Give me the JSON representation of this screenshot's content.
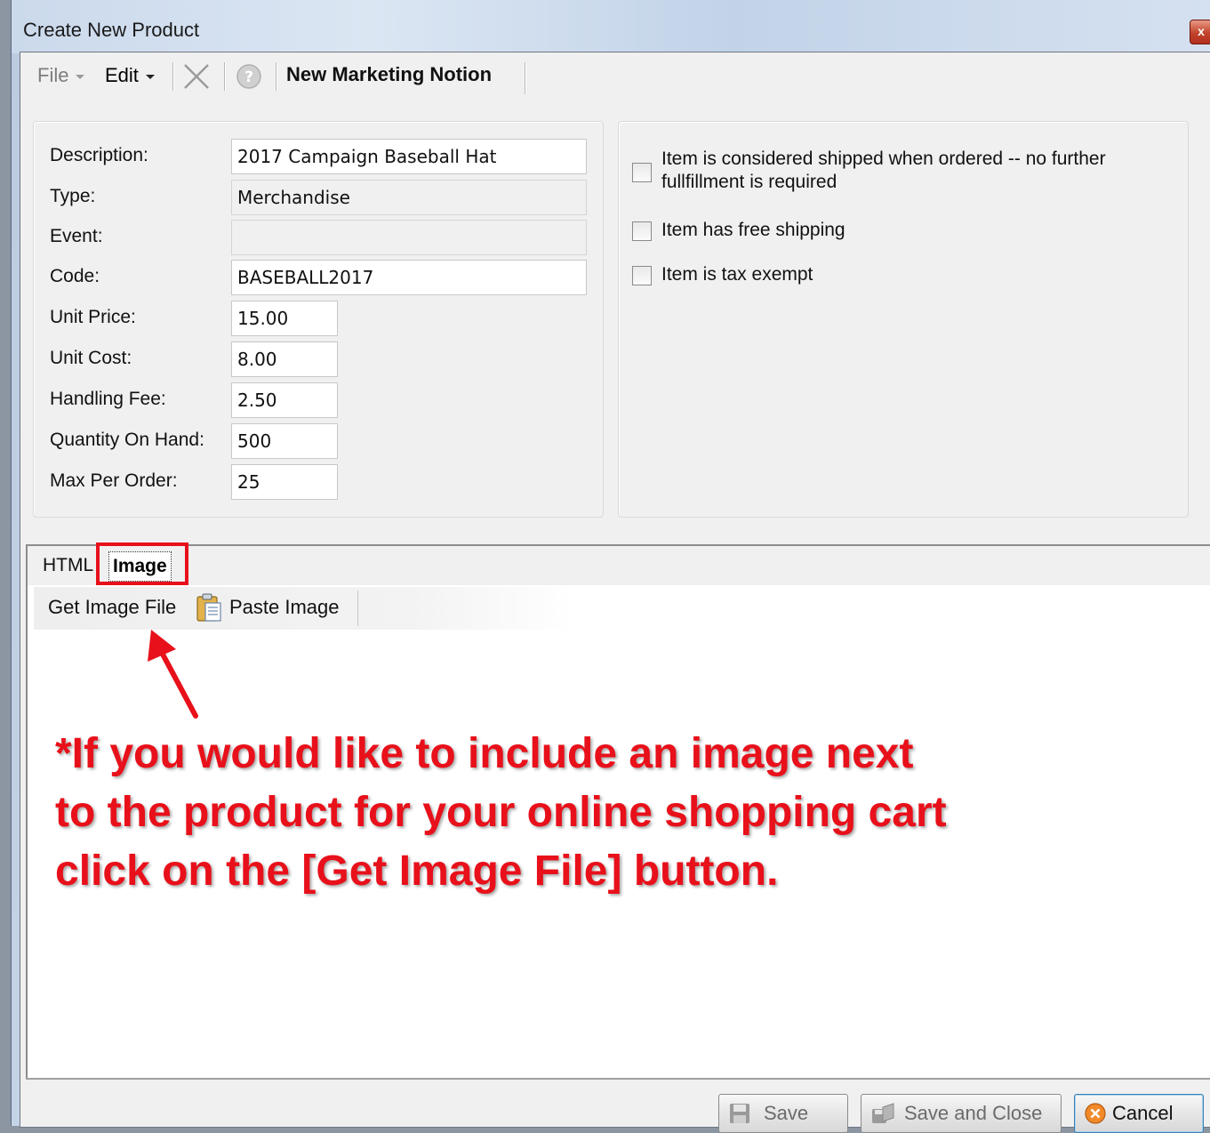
{
  "window": {
    "title": "Create New Product",
    "close_label": "x"
  },
  "menu": {
    "file": "File",
    "edit": "Edit",
    "title": "New Marketing Notion"
  },
  "form": {
    "description": {
      "label": "Description:",
      "value": "2017 Campaign Baseball Hat"
    },
    "type": {
      "label": "Type:",
      "value": "Merchandise"
    },
    "event": {
      "label": "Event:",
      "value": ""
    },
    "code": {
      "label": "Code:",
      "value": "BASEBALL2017"
    },
    "unit_price": {
      "label": "Unit Price:",
      "value": "15.00"
    },
    "unit_cost": {
      "label": "Unit Cost:",
      "value": "8.00"
    },
    "handling_fee": {
      "label": "Handling Fee:",
      "value": "2.50"
    },
    "quantity_on_hand": {
      "label": "Quantity On Hand:",
      "value": "500"
    },
    "max_per_order": {
      "label": "Max Per Order:",
      "value": "25"
    }
  },
  "options": {
    "shipped_when_ordered": {
      "label_line1": "Item is considered shipped when ordered -- no further",
      "label_line2": "fullfillment is required",
      "checked": false
    },
    "free_shipping": {
      "label": "Item has free shipping",
      "checked": false
    },
    "tax_exempt": {
      "label": "Item is tax exempt",
      "checked": false
    }
  },
  "tabs": {
    "html": "HTML",
    "image": "Image",
    "active": "Image"
  },
  "image_toolbar": {
    "get_image": "Get Image File",
    "paste_image": "Paste Image"
  },
  "annotation": {
    "line1": "*If you would like to include an image next",
    "line2": "to the product for your online shopping cart",
    "line3": "click on the [Get Image File] button.",
    "color": "#e8101a"
  },
  "footer": {
    "save": "Save",
    "save_close": "Save and Close",
    "cancel": "Cancel"
  }
}
